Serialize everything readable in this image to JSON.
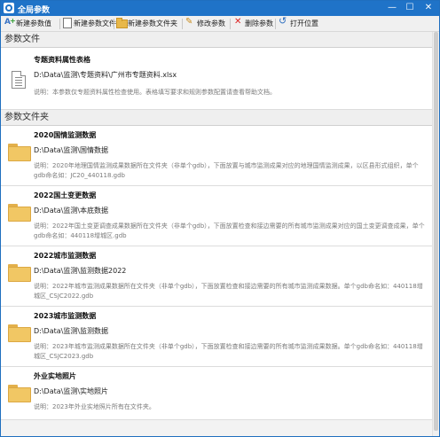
{
  "window": {
    "title": "全局参数",
    "minimize_glyph": "—",
    "maximize_glyph": "☐",
    "close_glyph": "✕"
  },
  "toolbar": {
    "items": [
      {
        "label": "新建参数值",
        "icon": "add-value-icon"
      },
      {
        "label": "新建参数文件",
        "icon": "add-file-icon"
      },
      {
        "label": "新建参数文件夹",
        "icon": "add-folder-icon"
      },
      {
        "label": "修改参数",
        "icon": "edit-icon"
      },
      {
        "label": "删除参数",
        "icon": "delete-icon"
      },
      {
        "label": "打开位置",
        "icon": "open-location-icon"
      }
    ]
  },
  "sections": {
    "files_header": "参数文件",
    "folders_header": "参数文件夹"
  },
  "param_files": [
    {
      "title": "专题资料属性表格",
      "path": "D:\\Data\\监测\\专题资料\\广州市专题资料.xlsx",
      "desc": "说明：本参数仅专题资料属性检查使用。表格填写要求和规则参数配置请查看帮助文档。"
    }
  ],
  "param_folders": [
    {
      "title": "2020国情监测数据",
      "path": "D:\\Data\\监测\\国情数据",
      "desc": "说明：2020年地理国情监测成果数据所在文件夹（非单个gdb），下面放置与城市监测成果对应的地理国情监测成果，以区县形式组织，单个gdb命名如：JC20_440118.gdb"
    },
    {
      "title": "2022国土变更数据",
      "path": "D:\\Data\\监测\\本底数据",
      "desc": "说明：2022年国土变更调查成果数据所在文件夹（非单个gdb），下面放置检查和接边需要的所有城市监测成果对应的国土变更调查成果，单个gdb命名如：440118增城区.gdb"
    },
    {
      "title": "2022城市监测数据",
      "path": "D:\\Data\\监测\\监测数据2022",
      "desc": "说明：2022年城市监测成果数据所在文件夹（非单个gdb），下面放置检查和接边需要的所有城市监测成果数据。单个gdb命名如：440118增城区_CSJC2022.gdb"
    },
    {
      "title": "2023城市监测数据",
      "path": "D:\\Data\\监测\\监测数据",
      "desc": "说明：2023年城市监测成果数据所在文件夹（非单个gdb），下面放置检查和接边需要的所有城市监测成果数据。单个gdb命名如：440118增城区_CSJC2023.gdb"
    },
    {
      "title": "外业实地照片",
      "path": "D:\\Data\\监测\\实地照片",
      "desc": "说明：2023年外业实地照片所有在文件夹。"
    }
  ]
}
